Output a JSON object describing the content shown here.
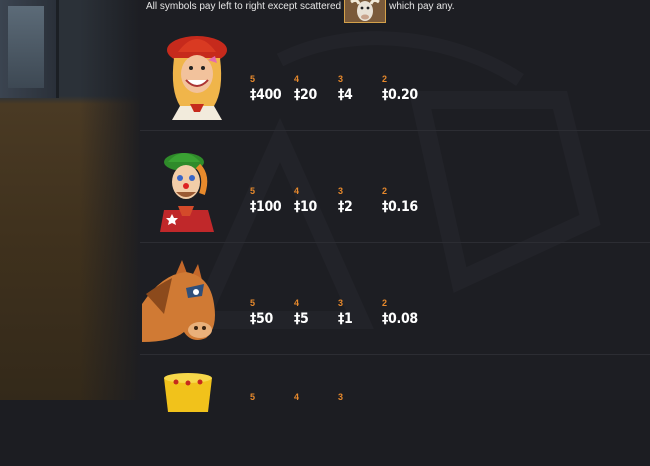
{
  "intro": {
    "text_before": "All symbols pay left to right except scattered",
    "text_after": "which pay any."
  },
  "currency_symbol": "‡",
  "paytable": [
    {
      "symbol": "cowgirl-icon",
      "pays": [
        {
          "count": "5",
          "amount": "‡400"
        },
        {
          "count": "4",
          "amount": "‡20"
        },
        {
          "count": "3",
          "amount": "‡4"
        },
        {
          "count": "2",
          "amount": "‡0.20"
        }
      ]
    },
    {
      "symbol": "clown-cowboy-icon",
      "pays": [
        {
          "count": "5",
          "amount": "‡100"
        },
        {
          "count": "4",
          "amount": "‡10"
        },
        {
          "count": "3",
          "amount": "‡2"
        },
        {
          "count": "2",
          "amount": "‡0.16"
        }
      ]
    },
    {
      "symbol": "horse-icon",
      "pays": [
        {
          "count": "5",
          "amount": "‡50"
        },
        {
          "count": "4",
          "amount": "‡5"
        },
        {
          "count": "3",
          "amount": "‡1"
        },
        {
          "count": "2",
          "amount": "‡0.08"
        }
      ]
    },
    {
      "symbol": "drum-icon",
      "pays": [
        {
          "count": "5",
          "amount": ""
        },
        {
          "count": "4",
          "amount": ""
        },
        {
          "count": "3",
          "amount": ""
        }
      ]
    }
  ],
  "colors": {
    "background": "#1d1e23",
    "count_label": "#e7892c",
    "amount": "#ffffff"
  }
}
